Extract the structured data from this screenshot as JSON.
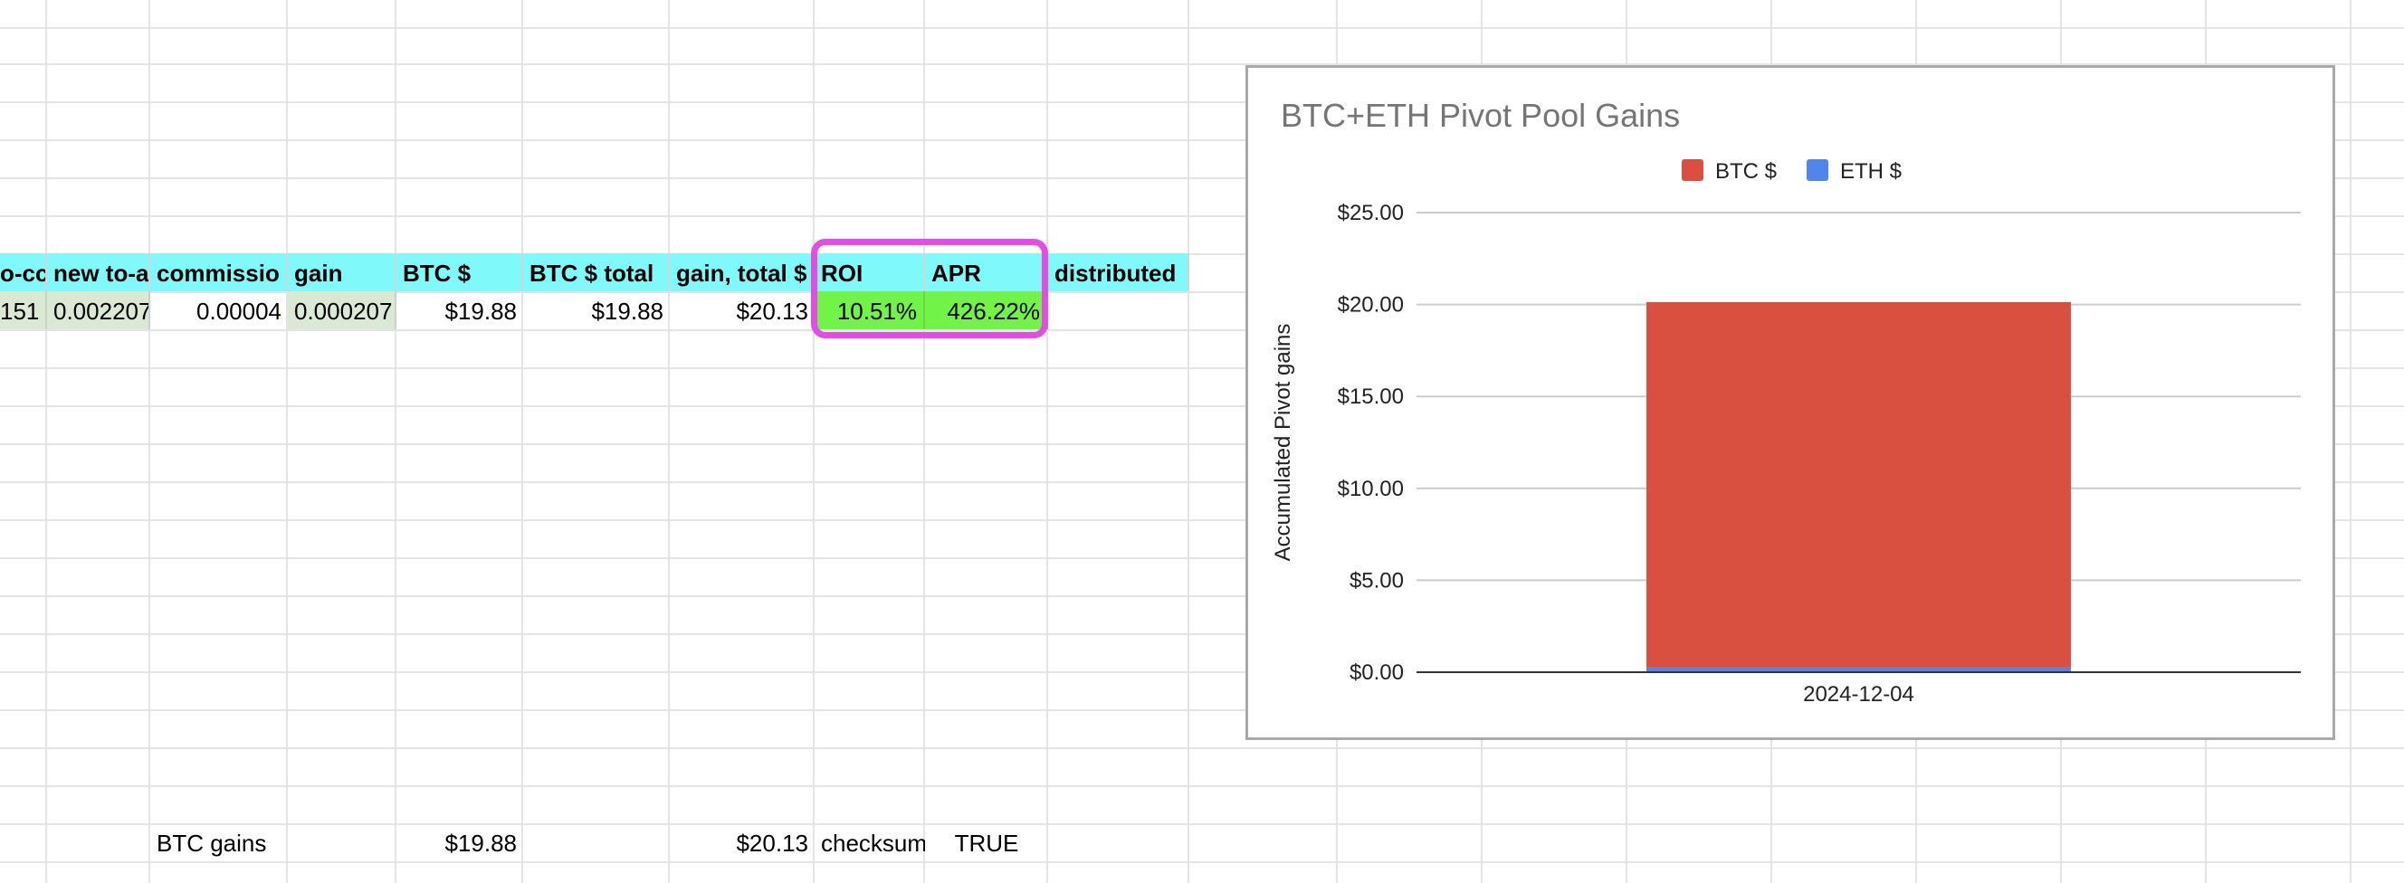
{
  "spreadsheet": {
    "header_row": [
      "o-cc",
      "new to-a",
      "commissio",
      "gain",
      "BTC $",
      "BTC $ total",
      "gain, total $",
      "ROI",
      "APR",
      "distributed"
    ],
    "data_row": [
      "151",
      "0.002207",
      "0.00004",
      "0.000207",
      "$19.88",
      "$19.88",
      "$20.13",
      "10.51%",
      "426.22%"
    ],
    "bottom_row": {
      "label": "BTC gains",
      "btc_dollars": "$19.88",
      "gain_total": "$20.13",
      "checksum_label": "checksum",
      "checksum_value": "TRUE"
    }
  },
  "highlight_color": "#e54ce6",
  "chart_data": {
    "type": "bar",
    "stacked": true,
    "title": "BTC+ETH Pivot Pool Gains",
    "xlabel": "",
    "ylabel": "Accumulated Pivot gains",
    "categories": [
      "2024-12-04"
    ],
    "series": [
      {
        "name": "BTC $",
        "color": "#d95040",
        "values": [
          19.88
        ]
      },
      {
        "name": "ETH $",
        "color": "#4f86ec",
        "values": [
          0.25
        ]
      }
    ],
    "ylim": [
      0,
      25
    ],
    "yticks": [
      "$0.00",
      "$5.00",
      "$10.00",
      "$15.00",
      "$20.00",
      "$25.00"
    ],
    "legend_position": "top",
    "grid": true
  }
}
